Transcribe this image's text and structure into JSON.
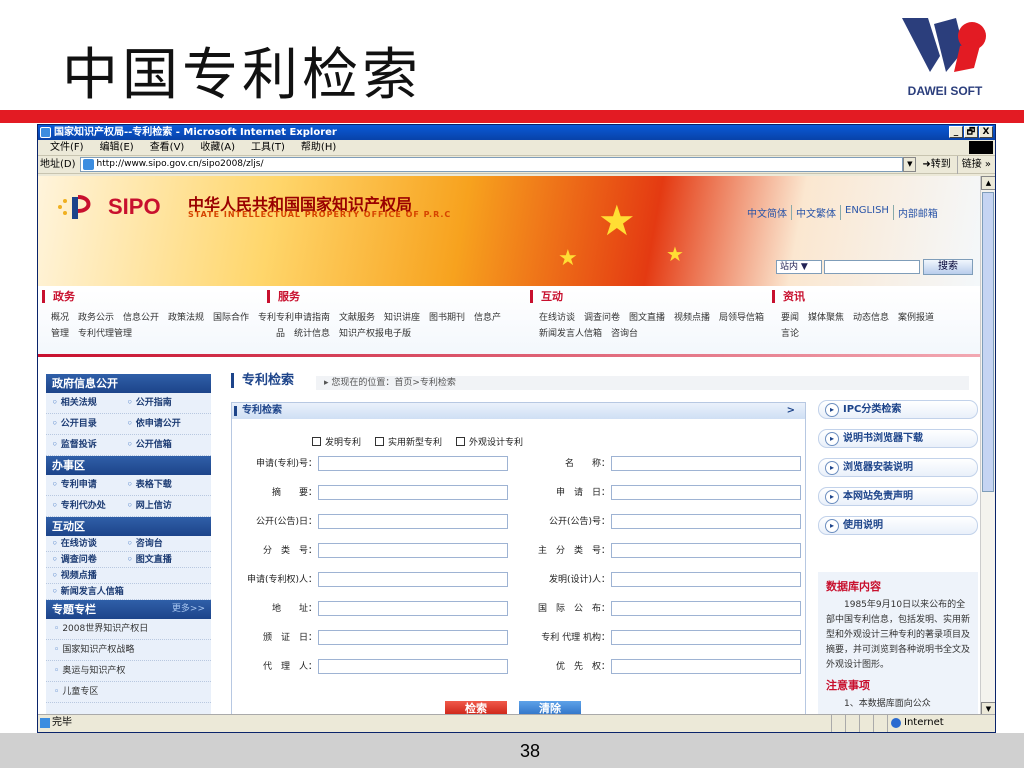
{
  "slide": {
    "title": "中国专利检索",
    "logo_text": "DAWEI SOFT",
    "page_number": "38",
    "colors": {
      "red_bar": "#e31b23",
      "logo_blue": "#2b3e7c",
      "logo_red": "#e31b23"
    }
  },
  "ie": {
    "title": "国家知识产权局--专利检索 - Microsoft Internet Explorer",
    "window_buttons": [
      "_",
      "🗗",
      "X"
    ],
    "menu": [
      "文件(F)",
      "编辑(E)",
      "查看(V)",
      "收藏(A)",
      "工具(T)",
      "帮助(H)"
    ],
    "address_label": "地址(D)",
    "address_value": "http://www.sipo.gov.cn/sipo2008/zljs/",
    "go_label": "转到",
    "links_label": "链接",
    "status_text": "完毕",
    "zone_text": "Internet"
  },
  "banner": {
    "logo": "SIPO",
    "title_cn": "中华人民共和国国家知识产权局",
    "title_en": "STATE INTELLECTUAL PROPERTY OFFICE OF P.R.C",
    "links": [
      "中文简体",
      "中文繁体",
      "ENGLISH",
      "内部邮箱"
    ],
    "site_select": "站内",
    "search_button": "搜索"
  },
  "nav": [
    {
      "title": "政务",
      "links": "概况　政务公示　信息公开　政策法规　国际合作　专利管理　专利代理管理"
    },
    {
      "title": "服务",
      "links": "专利申请指南　文献服务　知识讲座　图书期刊　信息产品　统计信息　知识产权报电子版"
    },
    {
      "title": "互动",
      "links": "在线访谈　调查问卷　图文直播　视频点播　局领导信箱　新闻发言人信箱　咨询台"
    },
    {
      "title": "资讯",
      "links": "要闻　媒体聚焦　动态信息　案例报道　言论"
    }
  ],
  "sidebar": {
    "sections": [
      {
        "header": "政府信息公开",
        "rows": [
          [
            "相关法规",
            "公开指南"
          ],
          [
            "公开目录",
            "依申请公开"
          ],
          [
            "监督投诉",
            "公开信箱"
          ]
        ]
      },
      {
        "header": "办事区",
        "rows": [
          [
            "专利申请",
            "表格下载"
          ],
          [
            "专利代办处",
            "网上信访"
          ]
        ]
      },
      {
        "header": "互动区",
        "rows": [
          [
            "在线访谈",
            "咨询台"
          ],
          [
            "调查问卷",
            "图文直播"
          ],
          [
            "视频点播",
            ""
          ],
          [
            "新闻发言人信箱",
            ""
          ]
        ]
      }
    ],
    "special": {
      "header": "专题专栏",
      "more": "更多>>",
      "items": [
        "2008世界知识产权日",
        "国家知识产权战略",
        "奥运与知识产权",
        "儿童专区"
      ]
    }
  },
  "main": {
    "title": "专利检索",
    "breadcrumb": "您现在的位置：首页>专利检索",
    "panel_title": "专利检索",
    "panel_arrow": ">",
    "checkboxes": [
      "发明专利",
      "实用新型专利",
      "外观设计专利"
    ],
    "left_fields": [
      "申请(专利)号：",
      "摘　　要：",
      "公开(公告)日：",
      "分　类　号：",
      "申请(专利权)人：",
      "地　　址：",
      "颁　证　日：",
      "代　理　人："
    ],
    "right_fields": [
      "名　　称：",
      "申　请　日：",
      "公开(公告)号：",
      "主　分　类　号：",
      "发明(设计)人：",
      "国　际　公　布：",
      "专利 代理 机构：",
      "优　先　权："
    ],
    "search_button": "检索",
    "clear_button": "清除"
  },
  "right": {
    "buttons": [
      "IPC分类检索",
      "说明书浏览器下载",
      "浏览器安装说明",
      "本网站免责声明",
      "使用说明"
    ],
    "db_title": "数据库内容",
    "db_text": "1985年9月10日以来公布的全部中国专利信息，包括发明、实用新型和外观设计三种专利的著录项目及摘要，并可浏览到各种说明书全文及外观设计图形。",
    "notes_title": "注意事项",
    "notes_text": "1、本数据库面向公众"
  }
}
